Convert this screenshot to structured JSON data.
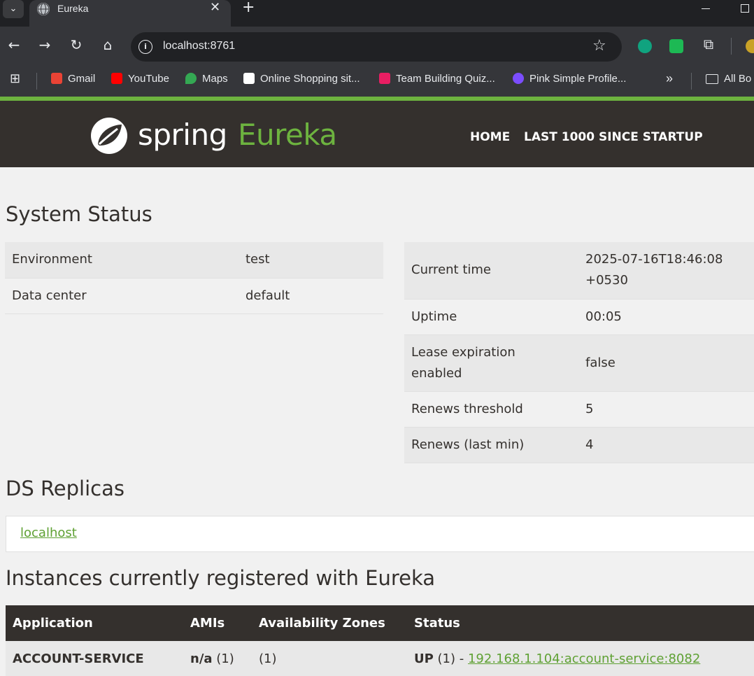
{
  "browser": {
    "tab_title": "Eureka",
    "tab_close": "✕",
    "new_tab": "+",
    "url": "localhost:8761",
    "bookmarks": [
      {
        "label": "Gmail",
        "icon": "gmail-icon",
        "color": "#ea4335"
      },
      {
        "label": "YouTube",
        "icon": "youtube-icon",
        "color": "#ff0000"
      },
      {
        "label": "Maps",
        "icon": "maps-icon",
        "color": "#34a853"
      },
      {
        "label": "Online Shopping sit...",
        "icon": "amazon-icon",
        "color": "#ffffff"
      },
      {
        "label": "Team Building Quiz...",
        "icon": "quiz-icon",
        "color": "#e91e63"
      },
      {
        "label": "Pink Simple Profile...",
        "icon": "canva-icon",
        "color": "#7b4dff"
      }
    ],
    "bookmarks_overflow": "»",
    "all_bookmarks": "All Bo"
  },
  "eureka": {
    "brand_spring": "spring",
    "brand_eureka": "Eureka",
    "nav": {
      "home": "HOME",
      "last1000": "LAST 1000 SINCE STARTUP"
    },
    "colors": {
      "accent": "#6db33f",
      "nav_bg": "#34302d",
      "link": "#5fa134"
    }
  },
  "system_status": {
    "title": "System Status",
    "left": [
      {
        "key": "Environment",
        "value": "test"
      },
      {
        "key": "Data center",
        "value": "default"
      }
    ],
    "right": [
      {
        "key": "Current time",
        "value_line1": "2025-07-16T18:46:08",
        "value_line2": "+0530"
      },
      {
        "key": "Uptime",
        "value_line1": "00:05",
        "value_line2": ""
      },
      {
        "key_line1": "Lease expiration",
        "key_line2": "enabled",
        "value_line1": "false",
        "value_line2": ""
      },
      {
        "key": "Renews threshold",
        "value_line1": "5",
        "value_line2": ""
      },
      {
        "key": "Renews (last min)",
        "value_line1": "4",
        "value_line2": ""
      }
    ]
  },
  "ds_replicas": {
    "title": "DS Replicas",
    "link": "localhost"
  },
  "instances": {
    "title": "Instances currently registered with Eureka",
    "headers": [
      "Application",
      "AMIs",
      "Availability Zones",
      "Status"
    ],
    "rows": [
      {
        "application": "ACCOUNT-SERVICE",
        "amis_bold": "n/a",
        "amis_count": " (1)",
        "zones": "(1)",
        "status_bold": "UP",
        "status_count": " (1) - ",
        "status_link": "192.168.1.104:account-service:8082"
      }
    ]
  }
}
